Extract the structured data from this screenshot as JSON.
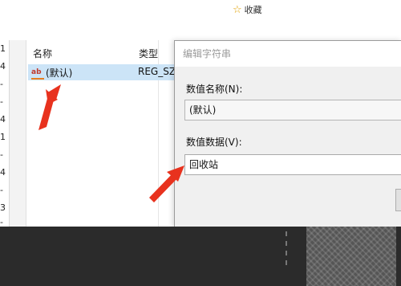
{
  "favorite": {
    "icon": "star-icon",
    "label": "收藏"
  },
  "tree": {
    "glyphs": [
      "1",
      "4",
      "-",
      "-",
      "4",
      "1",
      "-",
      "4",
      "-",
      "3",
      "-"
    ]
  },
  "list": {
    "columns": [
      "名称",
      "类型"
    ],
    "rows": [
      {
        "icon": "ab",
        "name": "(默认)",
        "type": "REG_SZ"
      }
    ]
  },
  "dialog": {
    "title": "编辑字符串",
    "name_label": "数值名称(N):",
    "name_value": "(默认)",
    "data_label": "数值数据(V):",
    "data_value": "回收站"
  },
  "colors": {
    "selection": "#cce4f7",
    "arrow": "#e8321e",
    "taskbar": "#2b2b2b"
  }
}
